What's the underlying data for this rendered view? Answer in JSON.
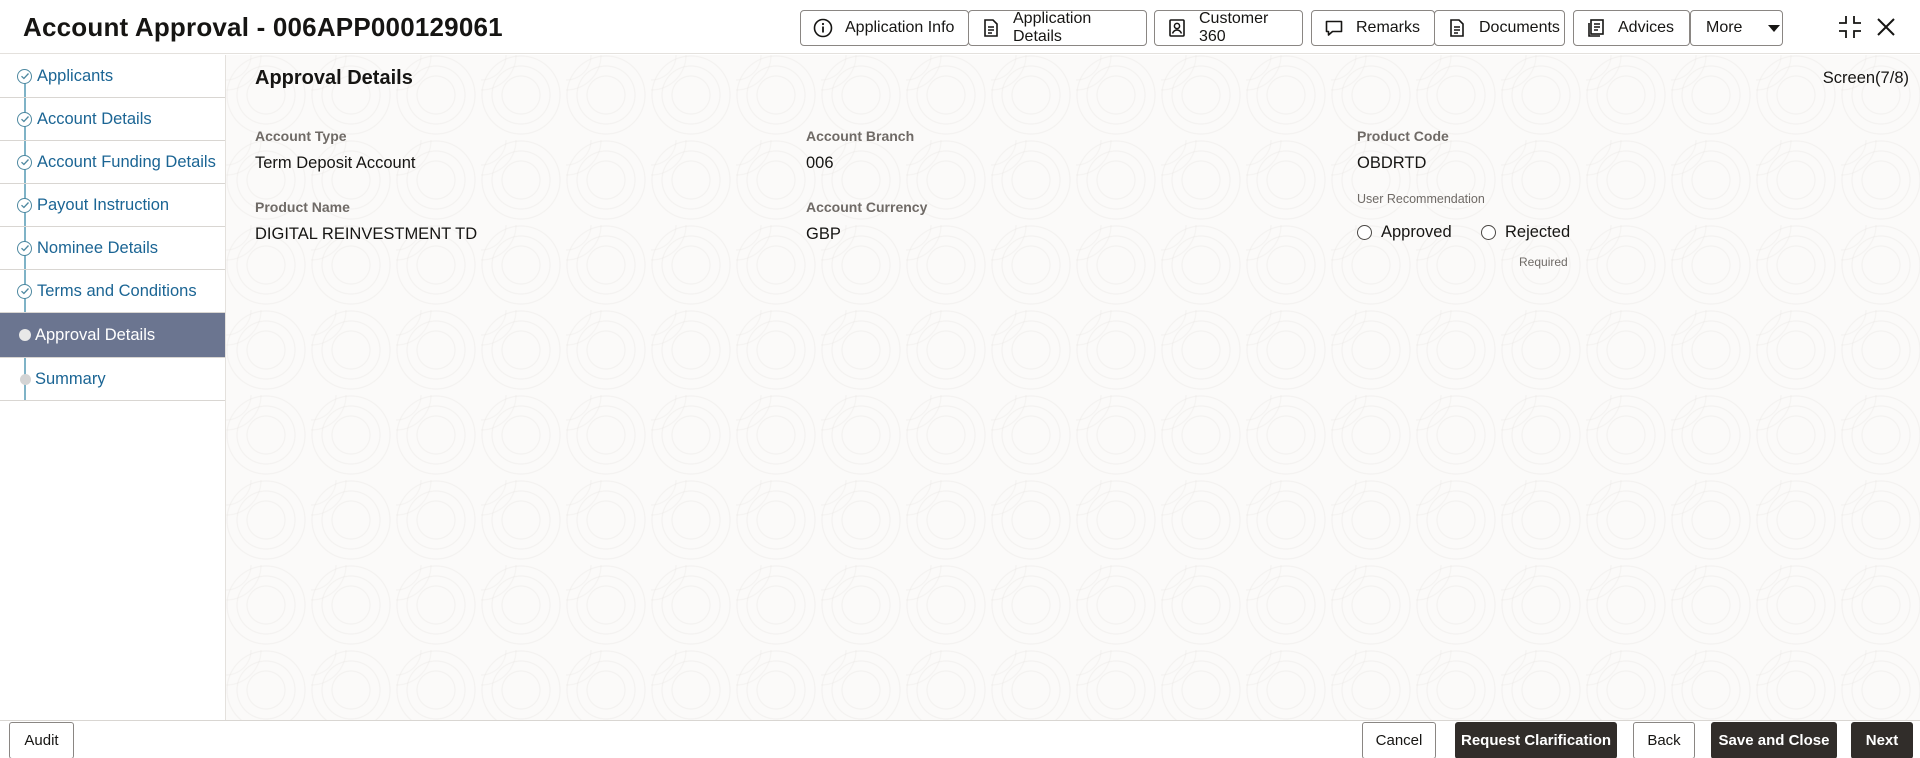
{
  "header": {
    "title": "Account Approval - 006APP000129061",
    "buttons": {
      "application_info": "Application Info",
      "application_details": "Application Details",
      "customer_360": "Customer 360",
      "remarks": "Remarks",
      "documents": "Documents",
      "advices": "Advices",
      "more": "More"
    }
  },
  "sidebar": {
    "items": [
      {
        "label": "Applicants",
        "state": "done"
      },
      {
        "label": "Account Details",
        "state": "done"
      },
      {
        "label": "Account Funding Details",
        "state": "done"
      },
      {
        "label": "Payout Instruction",
        "state": "done"
      },
      {
        "label": "Nominee Details",
        "state": "done"
      },
      {
        "label": "Terms and Conditions",
        "state": "done"
      },
      {
        "label": "Approval Details",
        "state": "active"
      },
      {
        "label": "Summary",
        "state": "pending"
      }
    ]
  },
  "main": {
    "section_title": "Approval Details",
    "screen_count": "Screen(7/8)",
    "fields": {
      "account_type": {
        "label": "Account Type",
        "value": "Term Deposit Account"
      },
      "account_branch": {
        "label": "Account Branch",
        "value": "006"
      },
      "product_code": {
        "label": "Product Code",
        "value": "OBDRTD"
      },
      "product_name": {
        "label": "Product Name",
        "value": "DIGITAL REINVESTMENT TD"
      },
      "account_currency": {
        "label": "Account Currency",
        "value": "GBP"
      }
    },
    "user_recommendation": {
      "label": "User Recommendation",
      "options": [
        "Approved",
        "Rejected"
      ],
      "required_text": "Required"
    }
  },
  "footer": {
    "audit": "Audit",
    "cancel": "Cancel",
    "request_clarification": "Request Clarification",
    "back": "Back",
    "save_and_close": "Save and Close",
    "next": "Next"
  },
  "colors": {
    "link": "#1b6594",
    "active_nav": "#6b7590",
    "dark_button": "#312d2a"
  }
}
